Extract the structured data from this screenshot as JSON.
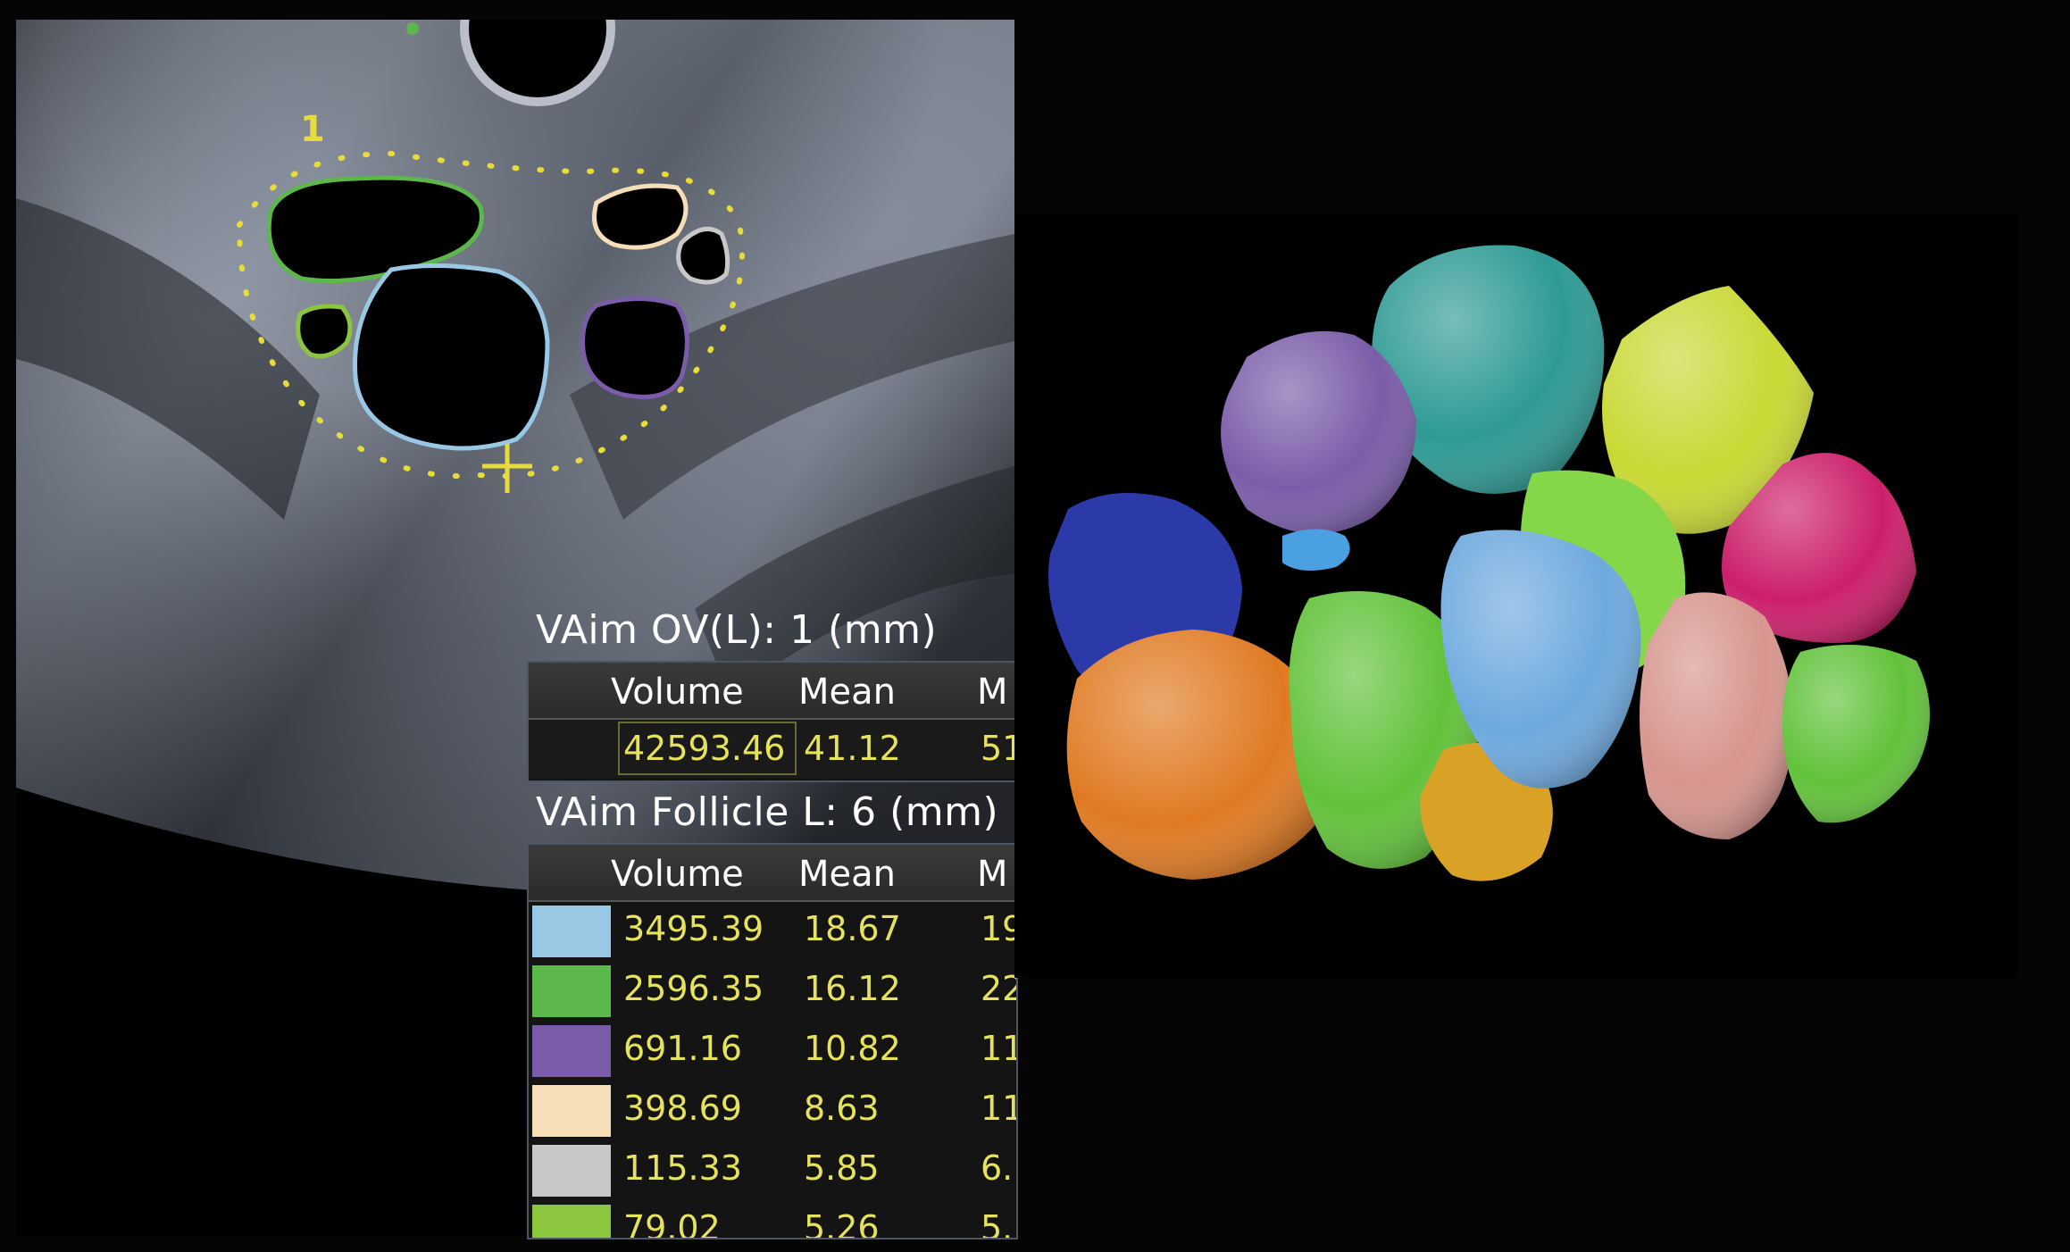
{
  "ultrasound": {
    "marker_number": "1"
  },
  "ovary_panel": {
    "title": "VAim OV(L): 1 (mm)",
    "columns": [
      "Volume",
      "Mean",
      "M"
    ],
    "row": {
      "volume": "42593.46",
      "mean": "41.12",
      "max": "51"
    }
  },
  "follicle_panel": {
    "title": "VAim Follicle L: 6 (mm)",
    "columns": [
      "Volume",
      "Mean",
      "M"
    ],
    "rows": [
      {
        "color": "#98c8e4",
        "volume": "3495.39",
        "mean": "18.67",
        "max": "19"
      },
      {
        "color": "#5cb84a",
        "volume": "2596.35",
        "mean": "16.12",
        "max": "22"
      },
      {
        "color": "#7a5ca8",
        "volume": "691.16",
        "mean": "10.82",
        "max": "11"
      },
      {
        "color": "#f6dfb8",
        "volume": "398.69",
        "mean": "8.63",
        "max": "11"
      },
      {
        "color": "#c8c8c8",
        "volume": "115.33",
        "mean": "5.85",
        "max": "6."
      },
      {
        "color": "#8cc63e",
        "volume": "79.02",
        "mean": "5.26",
        "max": "5."
      }
    ]
  },
  "colors": {
    "text_value": "#e6e35a",
    "outline_yellow": "#e8dc3a"
  }
}
